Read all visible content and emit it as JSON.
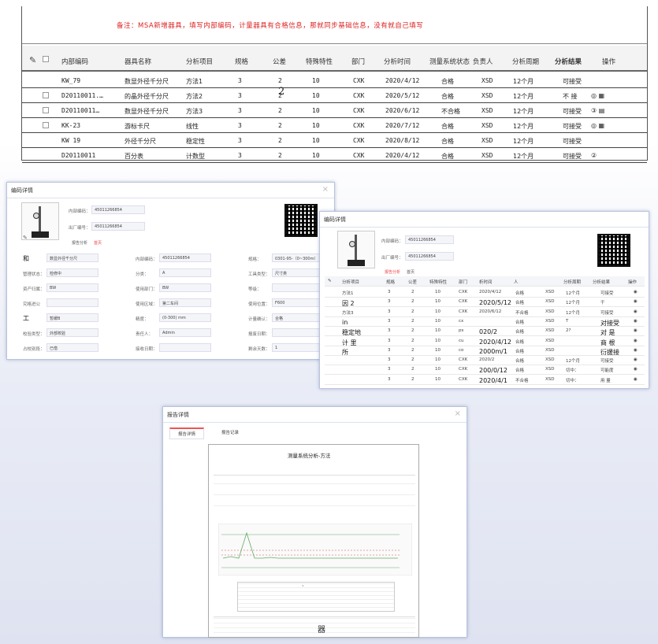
{
  "table": {
    "note": "备注：MSA新增器具，填写内部编码，计量器具有合格信息，那就同步基础信息，没有就自己填写",
    "headers": [
      "内部编码",
      "器具名称",
      "分析项目",
      "规格",
      "公差",
      "特殊特性",
      "部门",
      "分析时间",
      "测量系统状态",
      "负责人",
      "分析周期",
      "分析结果",
      "操作"
    ],
    "rows": [
      {
        "code": "KW_79",
        "name": "数显外径千分尺",
        "item": "方法1",
        "spec": "3",
        "tol": "2",
        "special": "10",
        "dept": "CXK",
        "time": "2020/4/12",
        "status": "合格",
        "owner": "XSD",
        "period": "12个月",
        "result": "可接受",
        "ops": ""
      },
      {
        "code": "D20110011.…",
        "name": "的晶外径千分尺",
        "item": "方法2",
        "spec": "3",
        "tol": "2",
        "special": "10",
        "dept": "CXK",
        "time": "2020/5/12",
        "status": "合格",
        "owner": "XSD",
        "period": "12个月",
        "result": "不 接",
        "ops": "◎  ▦"
      },
      {
        "code": "D20110011…",
        "name": "数显外径千分尺",
        "item": "方法3",
        "spec": "3",
        "tol": "2",
        "special": "10",
        "dept": "CXK",
        "time": "2020/6/12",
        "status": "不合格",
        "owner": "XSD",
        "period": "12个月",
        "result": "可接受",
        "ops": "③  ▤"
      },
      {
        "code": "KK-23",
        "name": "游标卡尺",
        "item": "线性",
        "spec": "3",
        "tol": "2",
        "special": "10",
        "dept": "CXK",
        "time": "2020/7/12",
        "status": "合格",
        "owner": "XSD",
        "period": "12个月",
        "result": "可接受",
        "ops": "◎  ▦"
      },
      {
        "code": "KW 19",
        "name": "外径千分尺",
        "item": "稳定性",
        "spec": "3",
        "tol": "2",
        "special": "10",
        "dept": "CXK",
        "time": "2020/8/12",
        "status": "合格",
        "owner": "XSD",
        "period": "12个月",
        "result": "可接受",
        "ops": ""
      },
      {
        "code": "D20110011",
        "name": "百分表",
        "item": "计数型",
        "spec": "3",
        "tol": "2",
        "special": "10",
        "dept": "CXK",
        "time": "2020/4/12",
        "status": "合格",
        "owner": "XSD",
        "period": "12个月",
        "result": "可接受",
        "ops": "②"
      }
    ],
    "overlay_2": "2"
  },
  "panel1": {
    "title": "编码详情",
    "fields_top": [
      {
        "label": "内部编码：",
        "value": "45011266854"
      },
      {
        "label": "出厂编号：",
        "value": "45011266854"
      }
    ],
    "tabs": [
      "报告分析",
      "首页"
    ],
    "grid": [
      {
        "label": "和",
        "value": "数显外径千分尺"
      },
      {
        "label": "内部编码：",
        "value": "45011266854"
      },
      {
        "label": "规格：",
        "value": "0301-95-（0~300m）"
      },
      {
        "label": "管理状态：",
        "value": "检修中"
      },
      {
        "label": "分类：",
        "value": "A"
      },
      {
        "label": "工具类型：",
        "value": "尺寸类"
      },
      {
        "label": "资产归属：",
        "value": "BW"
      },
      {
        "label": "使用部门：",
        "value": "BW"
      },
      {
        "label": "等级：",
        "value": ""
      },
      {
        "label": "究格进公",
        "value": ""
      },
      {
        "label": "使用区域：",
        "value": "第二车间"
      },
      {
        "label": "使用位置：",
        "value": "F600"
      },
      {
        "label": "工",
        "value": "暂缓B"
      },
      {
        "label": "精度：",
        "value": "(0-300) mm"
      },
      {
        "label": "计量确认：",
        "value": "合格"
      },
      {
        "label": "校验类型：",
        "value": "外部校验"
      },
      {
        "label": "责任人：",
        "value": "Admin"
      },
      {
        "label": "报废日期：",
        "value": ""
      },
      {
        "label": "占校别段：",
        "value": "已借"
      },
      {
        "label": "接收日期：",
        "value": ""
      },
      {
        "label": "剩余天数：",
        "value": "1"
      }
    ]
  },
  "panel2": {
    "title": "编码详情",
    "fields_top": [
      {
        "label": "内部编码：",
        "value": "45011266854"
      },
      {
        "label": "出厂编号：",
        "value": "45011266854"
      }
    ],
    "tabs": [
      "报告分析",
      "首页"
    ],
    "headers": [
      "分析项目",
      "规格",
      "公差",
      "特殊特性",
      "部门",
      "析时间",
      "人",
      "分析周期",
      "分析结果",
      "操作"
    ],
    "rows": [
      {
        "item": "方法1",
        "spec": "3",
        "tol": "2",
        "sp": "10",
        "dept": "CXK",
        "time": "2020/4/12",
        "st": "合格",
        "own": "XSD",
        "per": "12个月",
        "res": "可接受"
      },
      {
        "item": "因 2",
        "spec": "3",
        "tol": "2",
        "sp": "10",
        "dept": "CXK",
        "time": "2020/5/12",
        "st": "合格",
        "own": "XSD",
        "per": "12个月",
        "res": "干"
      },
      {
        "item": "方法3",
        "spec": "3",
        "tol": "2",
        "sp": "10",
        "dept": "CXK",
        "time": "2020/6/12",
        "st": "不合格",
        "own": "XSD",
        "per": "12个月",
        "res": "可接受"
      },
      {
        "item": "in",
        "spec": "3",
        "tol": "2",
        "sp": "10",
        "dept": "cx",
        "time": "",
        "st": "合格",
        "own": "XSD",
        "per": "T",
        "res": "对接受"
      },
      {
        "item": "稳定地",
        "spec": "3",
        "tol": "2",
        "sp": "10",
        "dept": "ps",
        "time": "020/2",
        "st": "合格",
        "own": "XSD",
        "per": "2?",
        "res": "对 是"
      },
      {
        "item": "计 里",
        "spec": "3",
        "tol": "2",
        "sp": "10",
        "dept": "cu",
        "time": "2020/4/12",
        "st": "合格",
        "own": "XSD",
        "per": "",
        "res": "商 根"
      },
      {
        "item": "所",
        "spec": "3",
        "tol": "2",
        "sp": "10",
        "dept": "co",
        "time": "2000m/1",
        "st": "合格",
        "own": "XSD",
        "per": "",
        "res": "衍援接"
      },
      {
        "item": "",
        "spec": "3",
        "tol": "2",
        "sp": "10",
        "dept": "CXK",
        "time": "2020/2",
        "st": "合格",
        "own": "XSD",
        "per": "12个月",
        "res": "可接受"
      },
      {
        "item": "",
        "spec": "3",
        "tol": "2",
        "sp": "10",
        "dept": "CXK",
        "time": "200/0/12",
        "st": "合格",
        "own": "XSD",
        "per": "切中：",
        "res": "可能度"
      },
      {
        "item": "",
        "spec": "3",
        "tol": "2",
        "sp": "10",
        "dept": "CXK",
        "time": "2020/4/1",
        "st": "不合格",
        "own": "XSD",
        "per": "切中：",
        "res": "用 量"
      }
    ]
  },
  "panel3": {
    "title": "报告详情",
    "tabs": [
      "报告详情",
      "报告记录"
    ],
    "doc_title": "测量系统分析-方法",
    "char_bottom": "器",
    "dot": "·"
  }
}
